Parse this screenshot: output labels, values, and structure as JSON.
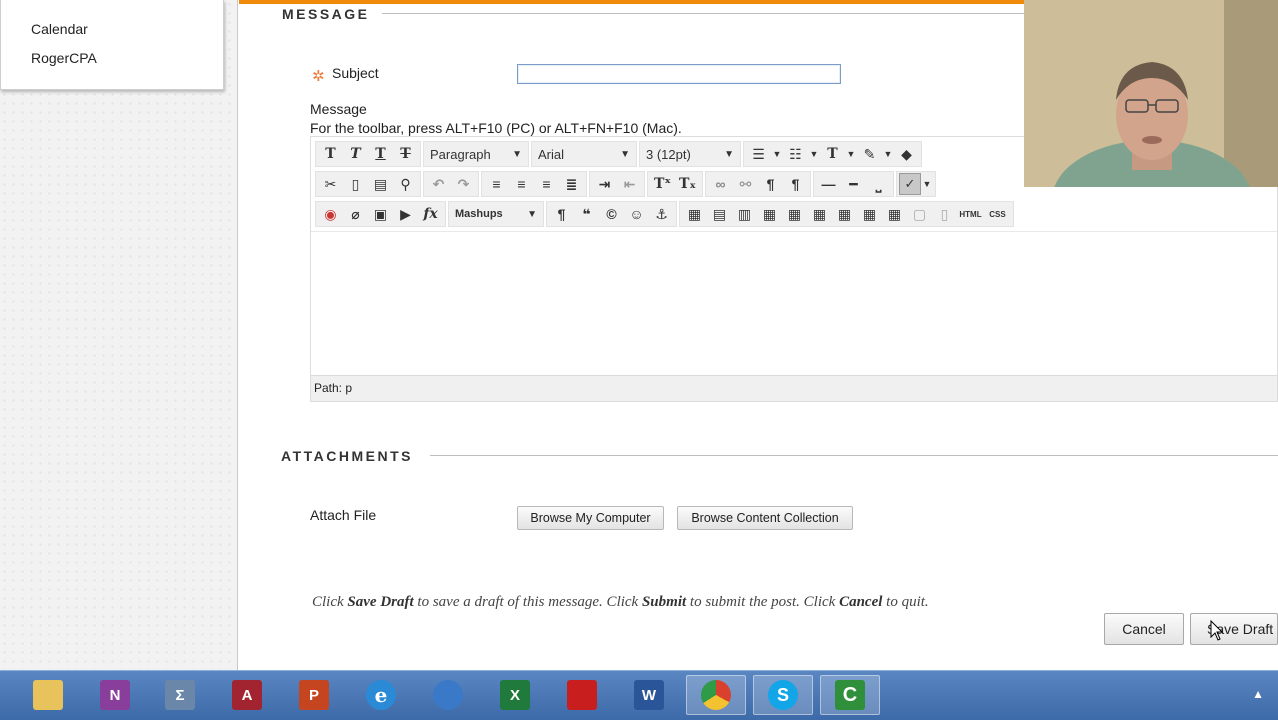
{
  "nav": {
    "items": [
      {
        "label": "Calendar"
      },
      {
        "label": "RogerCPA"
      }
    ]
  },
  "message_section": {
    "title": "MESSAGE",
    "subject_label": "Subject",
    "subject_value": "",
    "message_label": "Message",
    "toolbar_hint": "For the toolbar, press ALT+F10 (PC) or ALT+FN+F10 (Mac)."
  },
  "toolbar": {
    "format_select": "Paragraph",
    "font_select": "Arial",
    "size_select": "3 (12pt)",
    "mashups_label": "Mashups",
    "html_label": "HTML",
    "css_label": "CSS"
  },
  "editor": {
    "path_label": "Path: p"
  },
  "attachments": {
    "title": "ATTACHMENTS",
    "attach_label": "Attach File",
    "browse_computer": "Browse My Computer",
    "browse_collection": "Browse Content Collection"
  },
  "instructions": {
    "part1": "Click ",
    "save_draft": "Save Draft",
    "part2": " to save a draft of this message. Click ",
    "submit": "Submit",
    "part3": " to submit the post. Click ",
    "cancel": "Cancel",
    "part4": " to quit."
  },
  "actions": {
    "cancel": "Cancel",
    "save_draft": "Save Draft"
  },
  "taskbar": {
    "apps": [
      {
        "name": "file-explorer-icon",
        "label": "",
        "color": "#e8c25a"
      },
      {
        "name": "onenote-icon",
        "label": "N",
        "color": "#8a3e9c"
      },
      {
        "name": "sum-tool-icon",
        "label": "Σ",
        "color": "#6a86a8"
      },
      {
        "name": "access-icon",
        "label": "A",
        "color": "#a32431"
      },
      {
        "name": "powerpoint-icon",
        "label": "P",
        "color": "#c4451f"
      },
      {
        "name": "internet-explorer-icon",
        "label": "e",
        "color": "#2a8ad6"
      },
      {
        "name": "network-icon",
        "label": "",
        "color": "#3a78c8"
      },
      {
        "name": "excel-icon",
        "label": "X",
        "color": "#1f7a3c"
      },
      {
        "name": "acrobat-icon",
        "label": "",
        "color": "#c81e1e"
      },
      {
        "name": "word-icon",
        "label": "W",
        "color": "#2a5699"
      },
      {
        "name": "chrome-icon",
        "label": "",
        "color": "#d9412e"
      },
      {
        "name": "skype-icon",
        "label": "S",
        "color": "#12a5e8"
      },
      {
        "name": "camtasia-icon",
        "label": "C",
        "color": "#2f8f3a"
      }
    ]
  },
  "colors": {
    "accent": "#f08a0a",
    "required": "#f07a3a",
    "taskbar": "#4a76b4"
  }
}
